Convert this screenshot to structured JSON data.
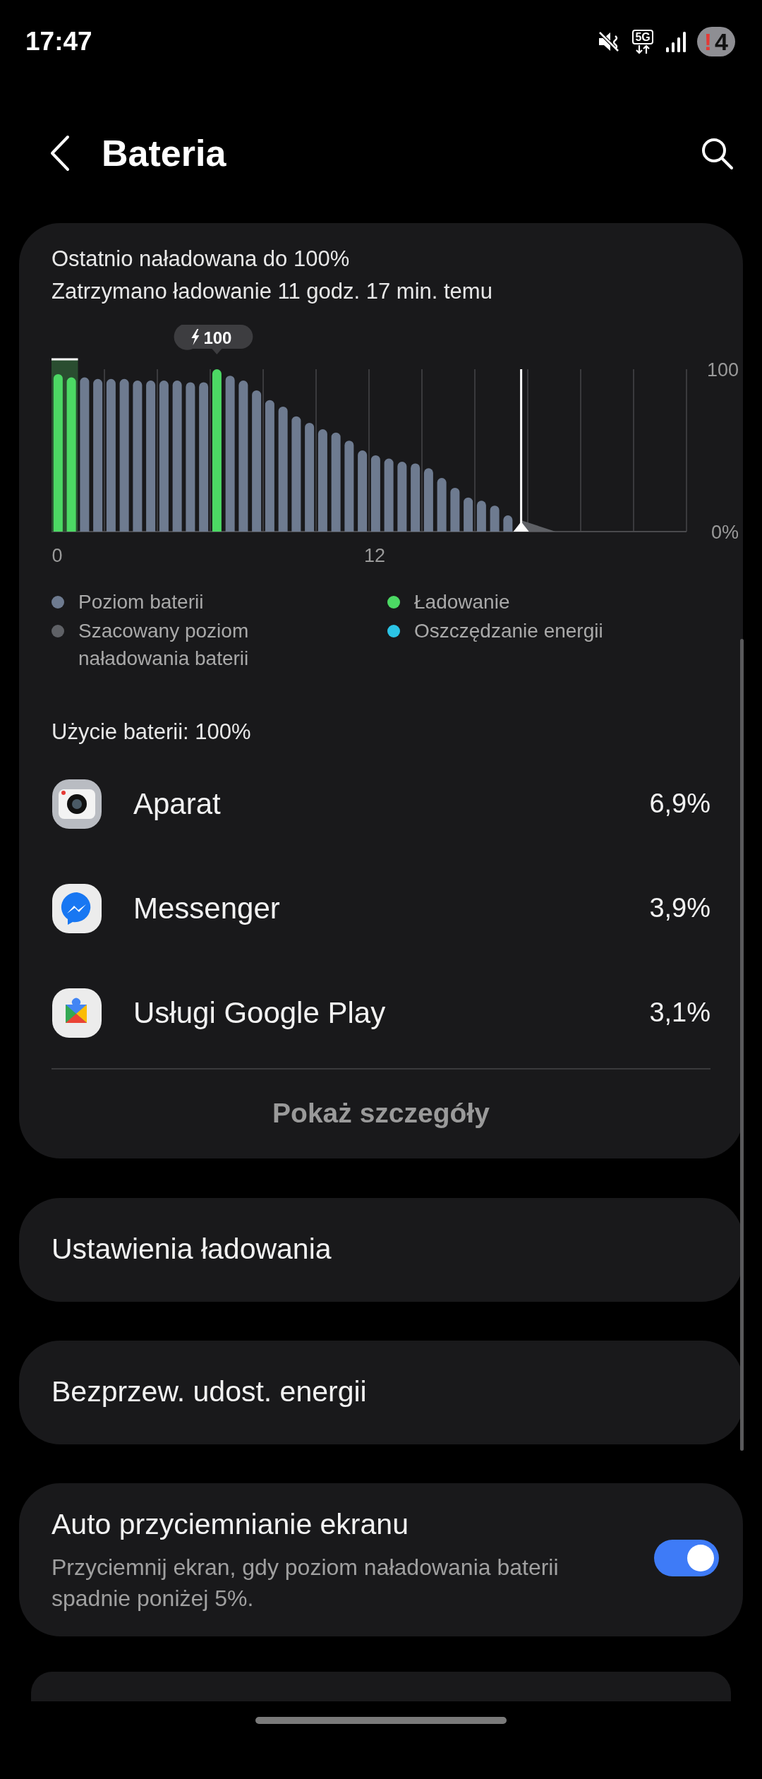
{
  "status_bar": {
    "time": "17:47",
    "network": "5G",
    "alert": "!",
    "notification_count": "4"
  },
  "header": {
    "title": "Bateria"
  },
  "summary": {
    "line_1": "Ostatnio naładowana do 100%",
    "line_2": "Zatrzymano ładowanie 11 godz. 17 min. temu"
  },
  "chart_data": {
    "type": "bar",
    "stacked": true,
    "x": [
      0.25,
      0.75,
      1.25,
      1.75,
      2.25,
      2.75,
      3.25,
      3.75,
      4.25,
      4.75,
      5.25,
      5.75,
      6.25,
      6.75,
      7.25,
      7.75,
      8.25,
      8.75,
      9.25,
      9.75,
      10.25,
      10.75,
      11.25,
      11.75,
      12.25,
      12.75,
      13.25,
      13.75,
      14.25,
      14.75,
      15.25,
      15.75,
      16.25,
      16.75,
      17.25
    ],
    "series": [
      {
        "name": "Poziom baterii",
        "color": "#6e7b90",
        "values": [
          null,
          null,
          95,
          94,
          94,
          94,
          93,
          93,
          93,
          93,
          92,
          92,
          null,
          96,
          93,
          87,
          81,
          77,
          71,
          67,
          63,
          61,
          56,
          50,
          47,
          45,
          43,
          42,
          39,
          33,
          27,
          21,
          19,
          16,
          10
        ]
      },
      {
        "name": "Ładowanie",
        "color": "#4cd964",
        "values": [
          97,
          95,
          null,
          null,
          null,
          null,
          null,
          null,
          null,
          null,
          null,
          null,
          100,
          null,
          null,
          null,
          null,
          null,
          null,
          null,
          null,
          null,
          null,
          null,
          null,
          null,
          null,
          null,
          null,
          null,
          null,
          null,
          null,
          null,
          null
        ]
      }
    ],
    "xlim": [
      0,
      24
    ],
    "ylim": [
      0,
      100
    ],
    "xticks": [
      0,
      12
    ],
    "yticks": [
      {
        "value": 0,
        "label": "0%"
      },
      {
        "value": 100,
        "label": "100"
      }
    ],
    "annotations": [
      "100"
    ],
    "bands": [
      {
        "axis": "x",
        "from": 0,
        "to": 1
      }
    ],
    "ref_lines": [
      {
        "axis": "x",
        "value": 17.75
      }
    ]
  },
  "legend_extra": [
    {
      "label": "Szacowany poziom naładowania baterii",
      "color": "#5f6166"
    },
    {
      "label": "Oszczędzanie energii",
      "color": "#2bc4e6"
    }
  ],
  "usage": {
    "title": "Użycie baterii: 100%",
    "apps": [
      {
        "kind": "camera",
        "name": "Aparat",
        "percent": "6,9%"
      },
      {
        "kind": "messenger",
        "name": "Messenger",
        "percent": "3,9%"
      },
      {
        "kind": "puzzle",
        "name": "Usługi Google Play",
        "percent": "3,1%"
      }
    ],
    "details_button": "Pokaż szczegóły"
  },
  "settings": [
    {
      "kind": "link",
      "title": "Ustawienia ładowania"
    },
    {
      "kind": "link",
      "title": "Bezprzew. udost. energii"
    },
    {
      "kind": "toggle",
      "title": "Auto przyciemnianie ekranu",
      "subtitle": "Przyciemnij ekran, gdy poziom naładowania baterii spadnie poniżej 5%.",
      "on": true
    }
  ]
}
